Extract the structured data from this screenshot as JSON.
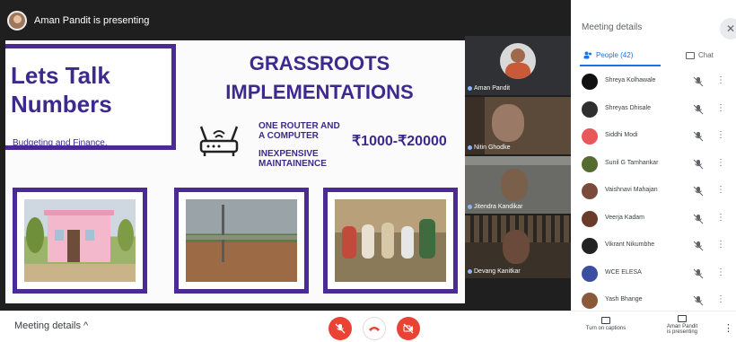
{
  "presenting": {
    "text": "Aman Pandit is presenting"
  },
  "slide": {
    "title_line1": "Lets Talk",
    "title_line2": "Numbers",
    "subtitle": "Budgeting and Finance.",
    "headline_line1": "GRASSROOTS",
    "headline_line2": "IMPLEMENTATIONS",
    "feature1_line1": "ONE ROUTER AND",
    "feature1_line2": "A COMPUTER",
    "feature2_line1": "INEXPENSIVE",
    "feature2_line2": "MAINTAINENCE",
    "price": "₹1000-₹20000"
  },
  "tiles": [
    {
      "name": "Aman Pandit"
    },
    {
      "name": "Nitin Ghodke"
    },
    {
      "name": "Jitendra Kandikar"
    },
    {
      "name": "Devang Kanitkar"
    }
  ],
  "panel": {
    "title": "Meeting details",
    "close": "✕",
    "tab_people": "People (42)",
    "tab_chat": "Chat",
    "people": [
      {
        "name": "Shreya Kolhawale",
        "color": "#111111"
      },
      {
        "name": "Shreyas Dhisale",
        "color": "#2f2f2f"
      },
      {
        "name": "Siddhi Modi",
        "color": "#e8585a"
      },
      {
        "name": "Sunil G Tamhankar",
        "color": "#556b2f"
      },
      {
        "name": "Vaishnavi Mahajan",
        "color": "#7a4b3a"
      },
      {
        "name": "Veerja Kadam",
        "color": "#6b3b2a"
      },
      {
        "name": "Vikrant Nikumbhe",
        "color": "#222222"
      },
      {
        "name": "WCE ELESA",
        "color": "#3b4ea0"
      },
      {
        "name": "Yash Bhange",
        "color": "#8a5a3a"
      }
    ]
  },
  "bottombar": {
    "meeting_details": "Meeting details ^",
    "captions": "Turn on captions",
    "present_line1": "Aman Pandit",
    "present_line2": "is presenting",
    "more": "⋮"
  },
  "colors": {
    "accent": "#4b2a95",
    "end_call": "#ea4335",
    "link": "#1a73e8"
  }
}
